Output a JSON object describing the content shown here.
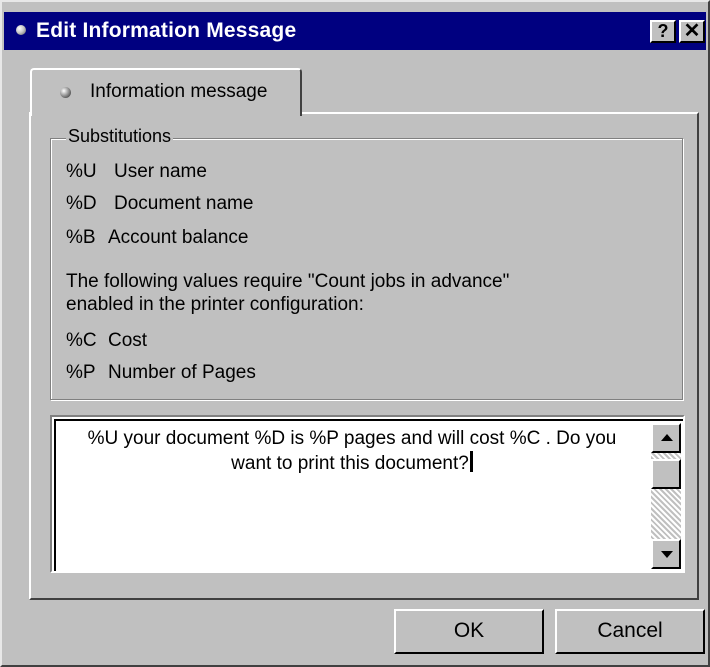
{
  "window": {
    "title": "Edit Information Message",
    "help_label": "?",
    "close_label": "✕"
  },
  "tab": {
    "label": "Information message"
  },
  "substitutions": {
    "legend": "Substitutions",
    "items": [
      {
        "code": "%U",
        "desc": "User name"
      },
      {
        "code": "%D",
        "desc": "Document name"
      },
      {
        "code": "%B",
        "desc": "Account balance"
      }
    ],
    "note_line1": "The following values require \"Count jobs in advance\"",
    "note_line2": "enabled in the printer configuration:",
    "advance_items": [
      {
        "code": "%C",
        "desc": "Cost"
      },
      {
        "code": "%P",
        "desc": "Number of Pages"
      }
    ]
  },
  "message": {
    "line1": "%U your document %D is %P pages  and will cost %C . Do you",
    "line2": "want to print this document?"
  },
  "buttons": {
    "ok": "OK",
    "cancel": "Cancel"
  },
  "colors": {
    "titlebar": "#000080",
    "face": "#c0c0c0"
  }
}
